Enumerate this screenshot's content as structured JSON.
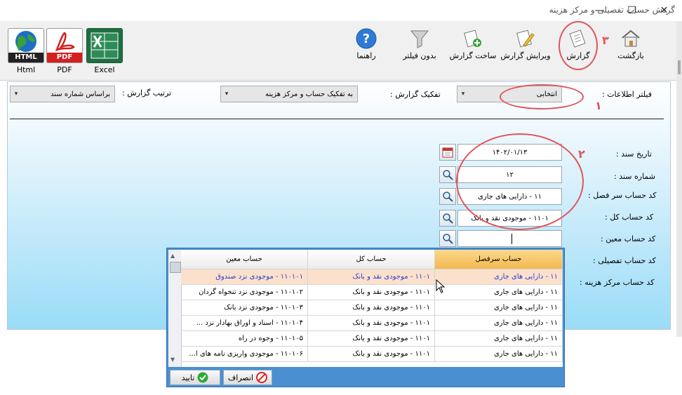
{
  "window": {
    "title": "گردش حساب تفصیلی و مرکز هزینه"
  },
  "toolbar": {
    "back_label": "بازگشت",
    "report_label": "گزارش",
    "edit_report_label": "ویرایش گزارش",
    "build_report_label": "ساخت گزارش",
    "no_filter_label": "بدون فیلتر",
    "help_label": "راهنما",
    "excel_label": "Excel",
    "pdf_label": "PDF",
    "html_label": "Html",
    "html_badge": "HTML",
    "pdf_badge": "PDF"
  },
  "filters": {
    "info_filter_label": "فیلتر اطلاعات :",
    "info_filter_value": "انتخابی",
    "breakdown_label": "تفکیک گزارش :",
    "breakdown_value": "به تفکیک حساب و مرکز هزینه",
    "order_label": "ترتیب گزارش :",
    "order_value": "براساس شماره سند"
  },
  "form": {
    "doc_date_label": "تاریخ سند :",
    "doc_date_value": "۱۴۰۲/۰۱/۱۳",
    "doc_number_label": "شماره سند :",
    "doc_number_value": "۱۲",
    "header_account_label": "کد حساب سر فصل :",
    "header_account_value": "۱۱ - دارایی های جاری",
    "general_account_label": "کد حساب کل :",
    "general_account_value": "۱۱۰۱ - موجودی نقد و بانک",
    "specific_account_label": "کد حساب معین :",
    "specific_account_value": "",
    "detail_account_label": "کد حساب تفصیلی :",
    "cost_center_label": "کد حساب مرکز هزینه :"
  },
  "annotations": {
    "n1": "۱",
    "n2": "۲",
    "n3": "۳"
  },
  "lookup": {
    "columns": [
      "حساب سرفصل",
      "حساب کل",
      "حساب معین"
    ],
    "rows": [
      [
        "۱۱ - دارایی های جاری",
        "۱۱۰۱ - موجودی نقد و بانک",
        "۱۱۰۱۰۱ - موجودی نزد صندوق"
      ],
      [
        "۱۱ - دارایی های جاری",
        "۱۱۰۱ - موجودی نقد و بانک",
        "۱۱۰۱۰۲ - موجودی نزد تنخواه گردان"
      ],
      [
        "۱۱ - دارایی های جاری",
        "۱۱۰۱ - موجودی نقد و بانک",
        "۱۱۰۱۰۳ - موجودی نزد بانک"
      ],
      [
        "۱۱ - دارایی های جاری",
        "۱۱۰۱ - موجودی نقد و بانک",
        "۱۱۰۱۰۴ - اسناد و اوراق بهادار نزد ..."
      ],
      [
        "۱۱ - دارایی های جاری",
        "۱۱۰۱ - موجودی نقد و بانک",
        "۱۱۰۱۰۵ - وجوه در راه"
      ],
      [
        "۱۱ - دارایی های جاری",
        "۱۱۰۱ - موجودی نقد و بانک",
        "۱۱۰۱۰۶ - موجودی واریزی نامه های ا..."
      ]
    ],
    "confirm_label": "تایید",
    "cancel_label": "انصراف"
  },
  "colors": {
    "accent_red": "#e0555a",
    "row_selected": "#fbe0cc",
    "header_selected": "#f7c46a",
    "link_blue": "#2a3fd0"
  }
}
